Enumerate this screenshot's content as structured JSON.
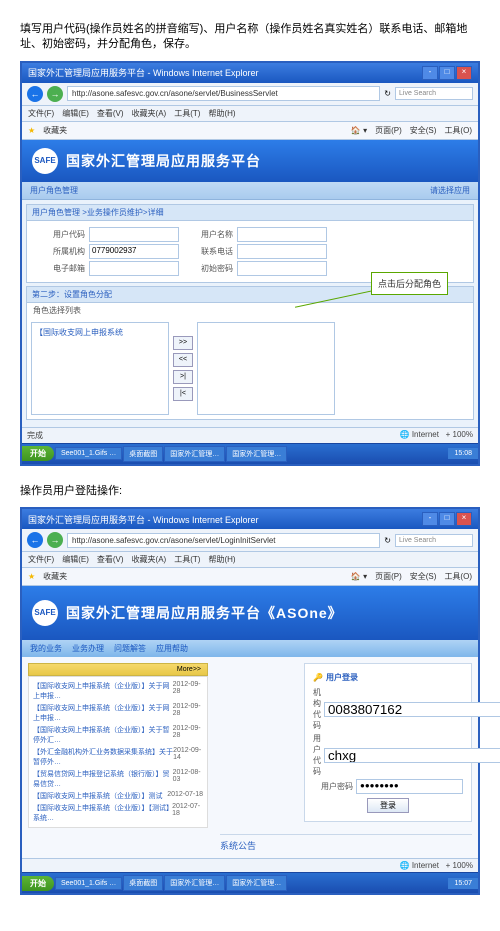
{
  "doc": {
    "instruction1": "填写用户代码(操作员姓名的拼音缩写)、用户名称（操作员姓名真实姓名）联系电话、邮箱地址、初始密码，并分配角色，保存。",
    "instruction2": "操作员用户登陆操作:"
  },
  "ie": {
    "title": "国家外汇管理局应用服务平台 - Windows Internet Explorer",
    "url1": "http://asone.safesvc.gov.cn/asone/servlet/BusinessServlet",
    "url2": "http://asone.safesvc.gov.cn/asone/servlet/LoginInitServlet",
    "menus": [
      "文件(F)",
      "编辑(E)",
      "查看(V)",
      "收藏夹(A)",
      "工具(T)",
      "帮助(H)"
    ],
    "fav": "收藏夹",
    "home": "首页",
    "page": "页面(P)",
    "safety": "安全(S)",
    "tools": "工具(O)",
    "search": "Live Search",
    "status_done": "完成",
    "status_net": "Internet",
    "status_zoom": "+ 100%"
  },
  "app1": {
    "banner": "国家外汇管理局应用服务平台",
    "breadcrumb": "请选择应用",
    "nav": "用户角色管理",
    "panel_title": "用户角色管理 >业务操作员维护>详细",
    "form": {
      "code_lbl": "用户代码",
      "code_val": "",
      "name_lbl": "用户名称",
      "name_val": "",
      "org_lbl": "所属机构",
      "org_val": "0779002937",
      "phone_lbl": "联系电话",
      "phone_val": "",
      "email_lbl": "电子邮箱",
      "email_val": "",
      "pwd_lbl": "初始密码",
      "pwd_val": ""
    },
    "role_step": "第二步：设置角色分配",
    "role_label": "角色选择列表",
    "role_item": "【国际收支网上申报系统",
    "callout": "点击后分配角色"
  },
  "app2": {
    "banner": "国家外汇管理局应用服务平台《ASOne》",
    "tabs": [
      "我的业务",
      "业务办理",
      "问题解答",
      "应用帮助"
    ],
    "more": "More>>",
    "news": [
      {
        "t": "【国际收支网上申报系统（企业版）】关于网上申报…",
        "d": "2012-09-28"
      },
      {
        "t": "【国际收支网上申报系统（企业版）】关于网上申报…",
        "d": "2012-09-28"
      },
      {
        "t": "【国际收支网上申报系统（企业版）】关于暂停外汇…",
        "d": "2012-09-28"
      },
      {
        "t": "【外汇金融机构外汇业务数据采集系统】关于暂停外…",
        "d": "2012-09-14"
      },
      {
        "t": "【贸易信贷网上申报登记系统（银行版）】贸易信贷…",
        "d": "2012-08-03"
      },
      {
        "t": "【国际收支网上申报系统（企业版）】测试",
        "d": "2012-07-18"
      },
      {
        "t": "【国际收支网上申报系统（企业版）】【测试】系统…",
        "d": "2012-07-18"
      }
    ],
    "login": {
      "head": "用户登录",
      "org_lbl": "机构代码",
      "org_val": "0083807162",
      "user_lbl": "用户代码",
      "user_val": "chxg",
      "pwd_lbl": "用户密码",
      "pwd_val": "●●●●●●●●",
      "btn": "登录"
    },
    "notice": "系统公告"
  },
  "tb": {
    "start": "开始",
    "items": [
      "See001_1.Gifs …",
      "桌面截图",
      "国家外汇管理…",
      "国家外汇管理…"
    ],
    "time1": "15:08",
    "time2": "15:07"
  }
}
